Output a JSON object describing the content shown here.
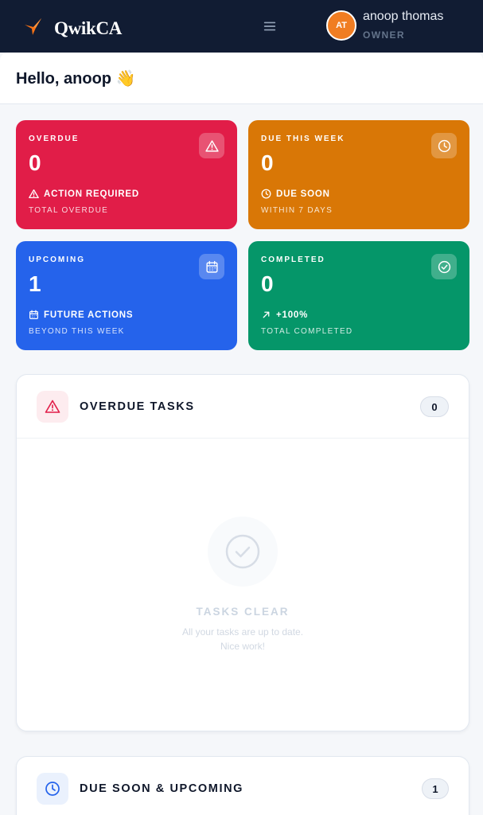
{
  "header": {
    "brand": "QwikCA",
    "logo_icon": "swallow-bird-icon",
    "menu_icon": "hamburger-menu-icon",
    "user": {
      "initials": "AT",
      "name": "anoop thomas",
      "role": "OWNER"
    }
  },
  "greeting": {
    "text": "Hello, anoop 👋"
  },
  "stats": [
    {
      "label": "OVERDUE",
      "value": "0",
      "note": "ACTION REQUIRED",
      "sub": "TOTAL OVERDUE",
      "icon": "warning-triangle-icon",
      "color": "#e11d48"
    },
    {
      "label": "DUE THIS WEEK",
      "value": "0",
      "note": "DUE SOON",
      "sub": "WITHIN 7 DAYS",
      "icon": "clock-icon",
      "color": "#d97706"
    },
    {
      "label": "UPCOMING",
      "value": "1",
      "note": "FUTURE ACTIONS",
      "sub": "BEYOND THIS WEEK",
      "icon": "calendar-icon",
      "color": "#2563eb"
    },
    {
      "label": "COMPLETED",
      "value": "0",
      "note": "+100%",
      "sub": "TOTAL COMPLETED",
      "icon": "check-circle-icon",
      "color": "#059669"
    }
  ],
  "overdue_panel": {
    "title": "OVERDUE TASKS",
    "count": "0",
    "icon": "warning-triangle-icon",
    "empty_title": "TASKS CLEAR",
    "empty_line1": "All your tasks are up to date.",
    "empty_line2": "Nice work!"
  },
  "due_panel": {
    "title": "DUE SOON & UPCOMING",
    "count": "1",
    "icon": "clock-icon"
  }
}
